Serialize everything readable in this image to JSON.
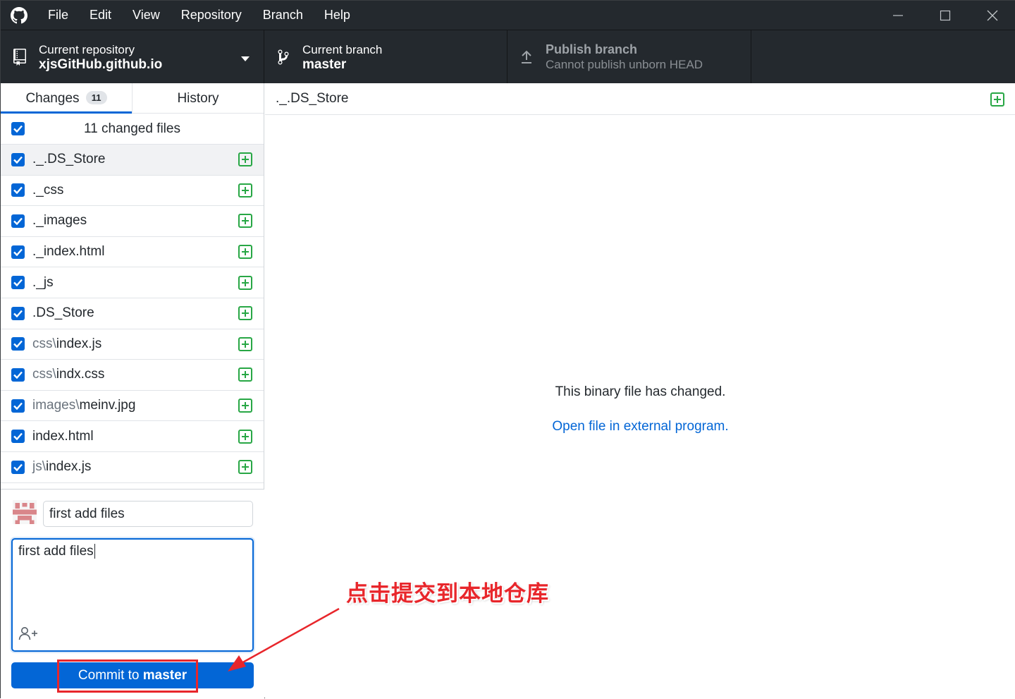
{
  "menu": [
    "File",
    "Edit",
    "View",
    "Repository",
    "Branch",
    "Help"
  ],
  "toolbar": {
    "repo_label": "Current repository",
    "repo_name": "xjsGitHub.github.io",
    "branch_label": "Current branch",
    "branch_name": "master",
    "publish_label": "Publish branch",
    "publish_desc": "Cannot publish unborn HEAD"
  },
  "tabs": {
    "changes_label": "Changes",
    "changes_count": "11",
    "history_label": "History"
  },
  "files_header": "11 changed files",
  "files": [
    {
      "dir": "",
      "name": "._.DS_Store"
    },
    {
      "dir": "",
      "name": "._css"
    },
    {
      "dir": "",
      "name": "._images"
    },
    {
      "dir": "",
      "name": "._index.html"
    },
    {
      "dir": "",
      "name": "._js"
    },
    {
      "dir": "",
      "name": ".DS_Store"
    },
    {
      "dir": "css\\",
      "name": "index.js"
    },
    {
      "dir": "css\\",
      "name": "indx.css"
    },
    {
      "dir": "images\\",
      "name": "meinv.jpg"
    },
    {
      "dir": "",
      "name": "index.html"
    },
    {
      "dir": "js\\",
      "name": "index.js"
    }
  ],
  "commit": {
    "summary_value": "first add files",
    "description_value": "first add files",
    "button_prefix": "Commit to ",
    "button_branch": "master"
  },
  "diff": {
    "file": "._.DS_Store",
    "binary_message": "This binary file has changed.",
    "open_link": "Open file in external program."
  },
  "annotation": {
    "text": "点击提交到本地仓库",
    "color": "#e8262b"
  },
  "colors": {
    "accent": "#0366d6",
    "titlebar": "#24292e",
    "added": "#28a745"
  }
}
